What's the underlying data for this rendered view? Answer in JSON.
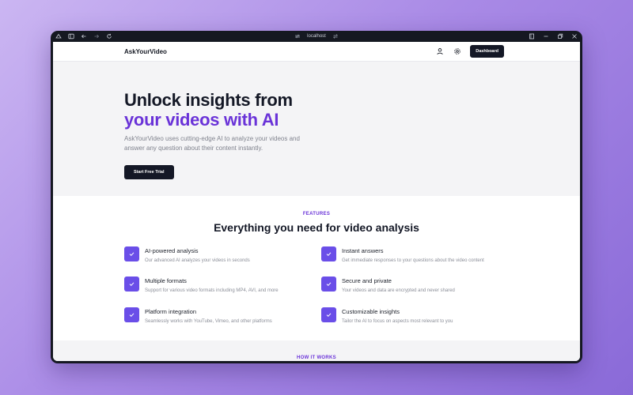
{
  "browser": {
    "url": "localhost",
    "icons": {
      "left": [
        "menu-icon",
        "sidebar-icon",
        "back-icon",
        "forward-icon",
        "reload-icon"
      ],
      "right": [
        "bookmark-icon",
        "minimize-icon",
        "restore-icon",
        "close-icon"
      ]
    }
  },
  "nav": {
    "brand": "AskYourVideo",
    "dashboard_label": "Dashboard"
  },
  "hero": {
    "title_line1": "Unlock insights from",
    "title_line2": "your videos with AI",
    "description": "AskYourVideo uses cutting-edge AI to analyze your videos and answer any question about their content instantly.",
    "cta_label": "Start Free Trial"
  },
  "features": {
    "eyebrow": "FEATURES",
    "title": "Everything you need for video analysis",
    "items": [
      {
        "title": "AI-powered analysis",
        "desc": "Our advanced AI analyzes your videos in seconds"
      },
      {
        "title": "Instant answers",
        "desc": "Get immediate responses to your questions about the video content"
      },
      {
        "title": "Multiple formats",
        "desc": "Support for various video formats including MP4, AVI, and more"
      },
      {
        "title": "Secure and private",
        "desc": "Your videos and data are encrypted and never shared"
      },
      {
        "title": "Platform integration",
        "desc": "Seamlessly works with YouTube, Vimeo, and other platforms"
      },
      {
        "title": "Customizable insights",
        "desc": "Tailor the AI to focus on aspects most relevant to you"
      }
    ]
  },
  "how": {
    "label": "HOW IT WORKS"
  },
  "colors": {
    "accent": "#6a33d8",
    "check_bg": "#6a4ee8",
    "dark": "#141826",
    "hero_bg": "#f4f4f6"
  }
}
